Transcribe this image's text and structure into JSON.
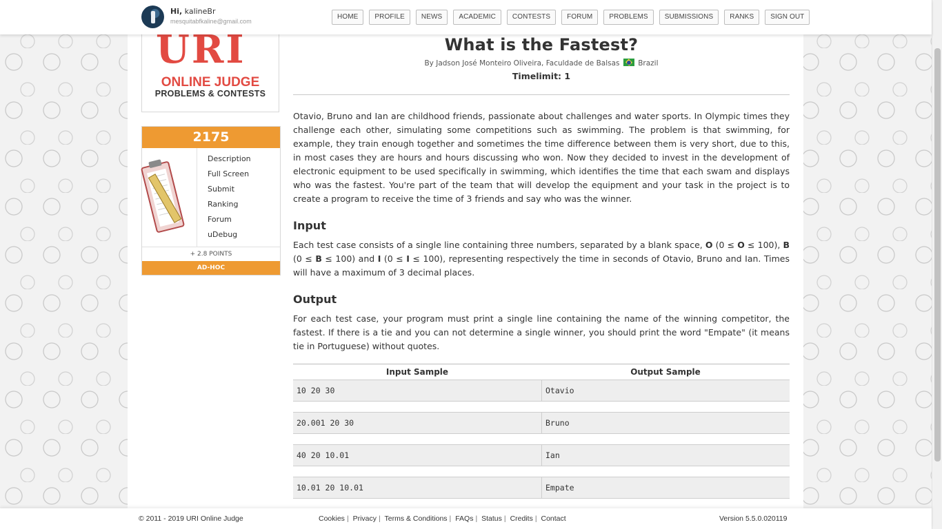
{
  "header": {
    "greeting_prefix": "Hi,",
    "username": "kalineBr",
    "email": "mesquitabfkaline@gmail.com",
    "nav": [
      "HOME",
      "PROFILE",
      "NEWS",
      "ACADEMIC",
      "CONTESTS",
      "FORUM",
      "PROBLEMS",
      "SUBMISSIONS",
      "RANKS",
      "SIGN OUT"
    ]
  },
  "logo": {
    "mark": "URI",
    "line1": "ONLINE JUDGE",
    "line2": "PROBLEMS & CONTESTS"
  },
  "card": {
    "problem_id": "2175",
    "menu": [
      "Description",
      "Full Screen",
      "Submit",
      "Ranking",
      "Forum",
      "uDebug"
    ],
    "points": "+ 2.8 POINTS",
    "category": "AD-HOC"
  },
  "problem": {
    "title": "What is the Fastest?",
    "author": "By Jadson José Monteiro Oliveira, Faculdade de Balsas",
    "country": "Brazil",
    "timelimit": "Timelimit: 1",
    "description": "Otavio, Bruno and Ian are childhood friends, passionate about challenges and water sports. In Olympic times they challenge each other, simulating some competitions such as swimming. The problem is that swimming, for example, they train enough together and sometimes the time difference between them is very short, due to this, in most cases they are hours and hours discussing who won. Now they decided to invest in the development of electronic equipment to be used specifically in swimming, which identifies the time that each swam and displays who was the fastest. You're part of the team that will develop the equipment and your task in the project is to create a program to receive the time of 3 friends and say who was the winner.",
    "input_heading": "Input",
    "input_text": {
      "t1": "Each test case consists of a single line containing three numbers, separated by a blank space, ",
      "v1": "O",
      "t2": " (0 ≤ ",
      "v2": "O",
      "t3": " ≤ 100), ",
      "v3": "B",
      "t4": " (0 ≤ ",
      "v4": "B",
      "t5": " ≤ 100) and ",
      "v5": "I",
      "t6": " (0 ≤ ",
      "v6": "I",
      "t7": " ≤ 100), representing respectively the time in seconds of Otavio, Bruno and Ian. Times will have a maximum of 3 decimal places."
    },
    "output_heading": "Output",
    "output_text": "For each test case, your program must print a single line containing the name of the winning competitor, the fastest. If there is a tie and you can not determine a single winner, you should print the word \"Empate\" (it means tie in Portuguese) without quotes."
  },
  "samples": {
    "input_header": "Input Sample",
    "output_header": "Output Sample",
    "rows": [
      {
        "input": "10 20 30",
        "output": "Otavio"
      },
      {
        "input": "20.001 20 30",
        "output": "Bruno"
      },
      {
        "input": "40 20 10.01",
        "output": "Ian"
      },
      {
        "input": "10.01 20 10.01",
        "output": "Empate"
      }
    ]
  },
  "footer": {
    "copyright": "© 2011 - 2019 URI Online Judge",
    "links": [
      "Cookies",
      "Privacy",
      "Terms & Conditions",
      "FAQs",
      "Status",
      "Credits",
      "Contact"
    ],
    "version": "Version 5.5.0.020119"
  }
}
